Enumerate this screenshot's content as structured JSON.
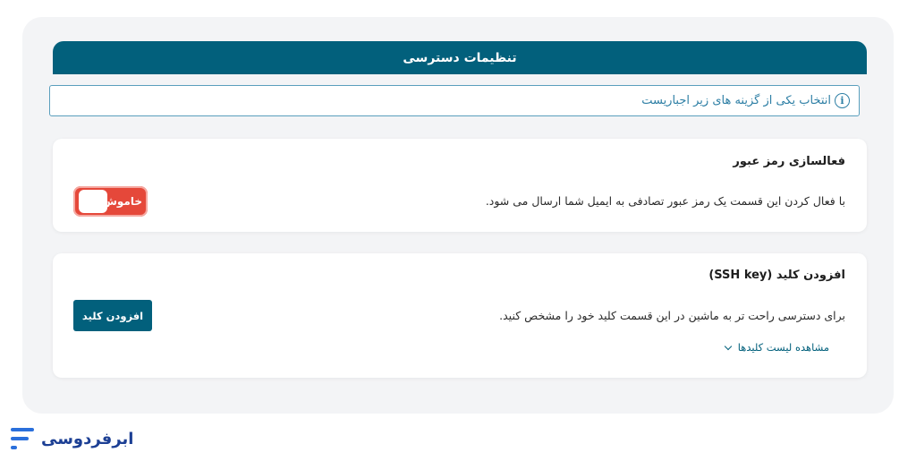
{
  "header": {
    "title": "تنظیمات دسترسی"
  },
  "notice": {
    "text": "انتخاب یکی از گزینه های زیر اجباریست",
    "icon": "info-icon"
  },
  "password_card": {
    "title": "فعالسازی رمز عبور",
    "description": "با فعال کردن این قسمت یک رمز عبور تصادفی به ایمیل شما ارسال می شود.",
    "toggle_label": "خاموش",
    "toggle_state": "off"
  },
  "ssh_card": {
    "title": "افزودن کلید (SSH key)",
    "description": "برای دسترسی راحت تر به ماشین در این قسمت کلید خود را مشخص کنید.",
    "button_label": "افزودن کلید",
    "keys_link": "مشاهده لیست کلیدها"
  },
  "brand": {
    "name": "ابرفردوسی"
  },
  "colors": {
    "primary": "#02607c",
    "toggle_off": "#e5483a",
    "notice_border": "#5a9fbd",
    "brand": "#1c3f94"
  }
}
